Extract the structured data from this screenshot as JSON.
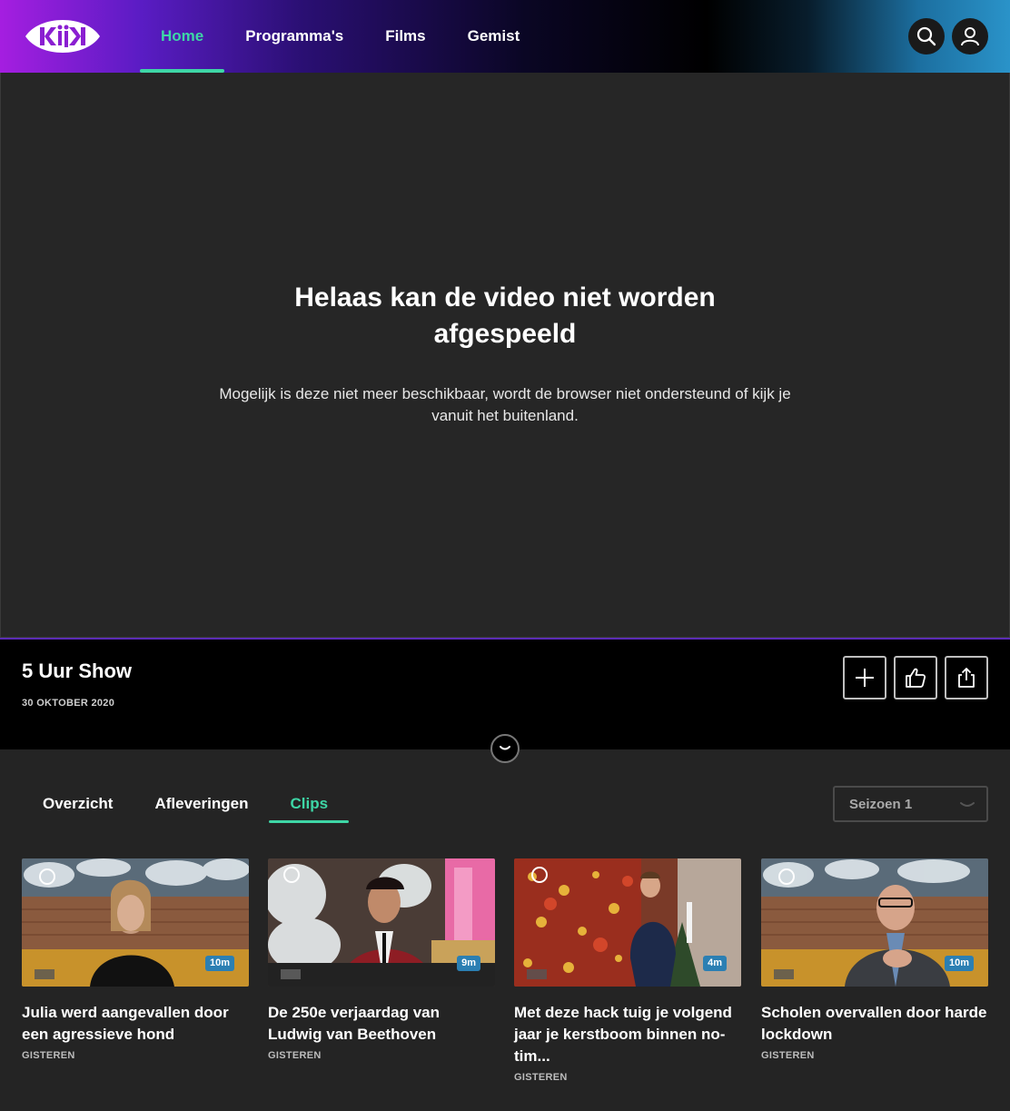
{
  "brand": {
    "logo_text": "KIJK",
    "accent": "#3ed6a6"
  },
  "nav": {
    "items": [
      {
        "label": "Home",
        "active": true
      },
      {
        "label": "Programma's",
        "active": false
      },
      {
        "label": "Films",
        "active": false
      },
      {
        "label": "Gemist",
        "active": false
      }
    ],
    "search_icon": "search-icon",
    "account_icon": "user-icon"
  },
  "player": {
    "error_title": "Helaas kan de video niet worden afgespeeld",
    "error_message": "Mogelijk is deze niet meer beschikbaar, wordt de browser niet ondersteund of kijk je vanuit het buitenland."
  },
  "show": {
    "title": "5 Uur Show",
    "date": "30 OKTOBER 2020",
    "actions": [
      "plus-icon",
      "thumbs-up-icon",
      "share-icon"
    ]
  },
  "tabs": [
    {
      "label": "Overzicht",
      "active": false
    },
    {
      "label": "Afleveringen",
      "active": false
    },
    {
      "label": "Clips",
      "active": true
    }
  ],
  "season_select": {
    "value": "Seizoen 1"
  },
  "clips": [
    {
      "title": "Julia werd aangevallen door een agressieve hond",
      "date": "GISTEREN",
      "duration": "10m"
    },
    {
      "title": "De 250e verjaardag van Ludwig van Beethoven",
      "date": "GISTEREN",
      "duration": "9m"
    },
    {
      "title": "Met deze hack tuig je volgend jaar je kerstboom binnen no-tim...",
      "date": "GISTEREN",
      "duration": "4m"
    },
    {
      "title": "Scholen overvallen door harde lockdown",
      "date": "GISTEREN",
      "duration": "10m"
    }
  ]
}
